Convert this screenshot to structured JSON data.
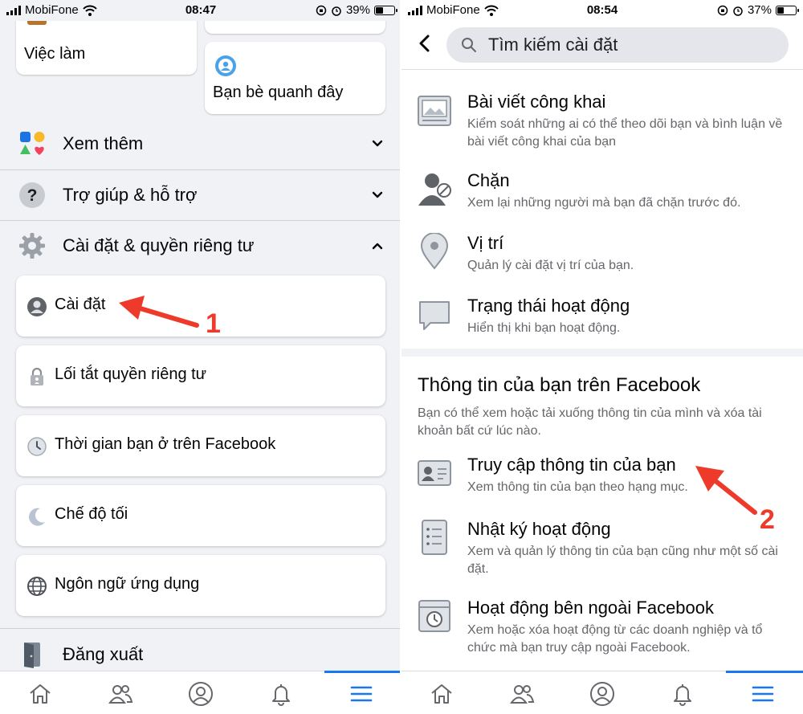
{
  "left": {
    "status": {
      "carrier": "MobiFone",
      "time": "08:47",
      "battery": "39%",
      "battery_level": 0.39
    },
    "cards": {
      "jobs": "Việc làm",
      "nearby": "Bạn bè quanh đây"
    },
    "menu": [
      {
        "label": "Xem thêm",
        "icon": "shapes-icon",
        "chevron": "down"
      },
      {
        "label": "Trợ giúp & hỗ trợ",
        "icon": "help-icon",
        "chevron": "down"
      },
      {
        "label": "Cài đặt & quyền riêng tư",
        "icon": "gear-icon",
        "chevron": "up"
      }
    ],
    "settings_items": [
      {
        "label": "Cài đặt",
        "icon": "person-icon"
      },
      {
        "label": "Lối tắt quyền riêng tư",
        "icon": "lock-icon"
      },
      {
        "label": "Thời gian bạn ở trên Facebook",
        "icon": "clock-icon"
      },
      {
        "label": "Chế độ tối",
        "icon": "moon-icon"
      },
      {
        "label": "Ngôn ngữ ứng dụng",
        "icon": "globe-icon"
      }
    ],
    "logout": "Đăng xuất",
    "annotation": "1"
  },
  "right": {
    "status": {
      "carrier": "MobiFone",
      "time": "08:54",
      "battery": "37%",
      "battery_level": 0.37
    },
    "search": {
      "placeholder": "Tìm kiếm cài đặt"
    },
    "items": [
      {
        "title": "Bài viết công khai",
        "desc": "Kiểm soát những ai có thể theo dõi bạn và bình luận về bài viết công khai của bạn",
        "icon": "public-posts-icon"
      },
      {
        "title": "Chặn",
        "desc": "Xem lại những người mà bạn đã chặn trước đó.",
        "icon": "block-icon"
      },
      {
        "title": "Vị trí",
        "desc": "Quản lý cài đặt vị trí của bạn.",
        "icon": "location-icon"
      },
      {
        "title": "Trạng thái hoạt động",
        "desc": "Hiển thị khi bạn hoạt động.",
        "icon": "chat-bubble-icon"
      }
    ],
    "section": {
      "title": "Thông tin của bạn trên Facebook",
      "desc": "Bạn có thể xem hoặc tải xuống thông tin của mình và xóa tài khoản bất cứ lúc nào."
    },
    "section_items": [
      {
        "title": "Truy cập thông tin của bạn",
        "desc": "Xem thông tin của bạn theo hạng mục.",
        "icon": "id-card-icon"
      },
      {
        "title": "Nhật ký hoạt động",
        "desc": "Xem và quản lý thông tin của bạn cũng như một số cài đặt.",
        "icon": "activity-log-icon"
      },
      {
        "title": "Hoạt động bên ngoài Facebook",
        "desc": "Xem hoặc xóa hoạt động từ các doanh nghiệp và tổ chức mà bạn truy cập ngoài Facebook.",
        "icon": "off-facebook-icon"
      }
    ],
    "annotation": "2"
  },
  "colors": {
    "accent": "#1877f2",
    "annotation": "#ee3a2a",
    "background": "#f0f2f5"
  },
  "tabs": [
    "home-icon",
    "friends-icon",
    "profile-icon",
    "notifications-icon",
    "menu-icon"
  ]
}
